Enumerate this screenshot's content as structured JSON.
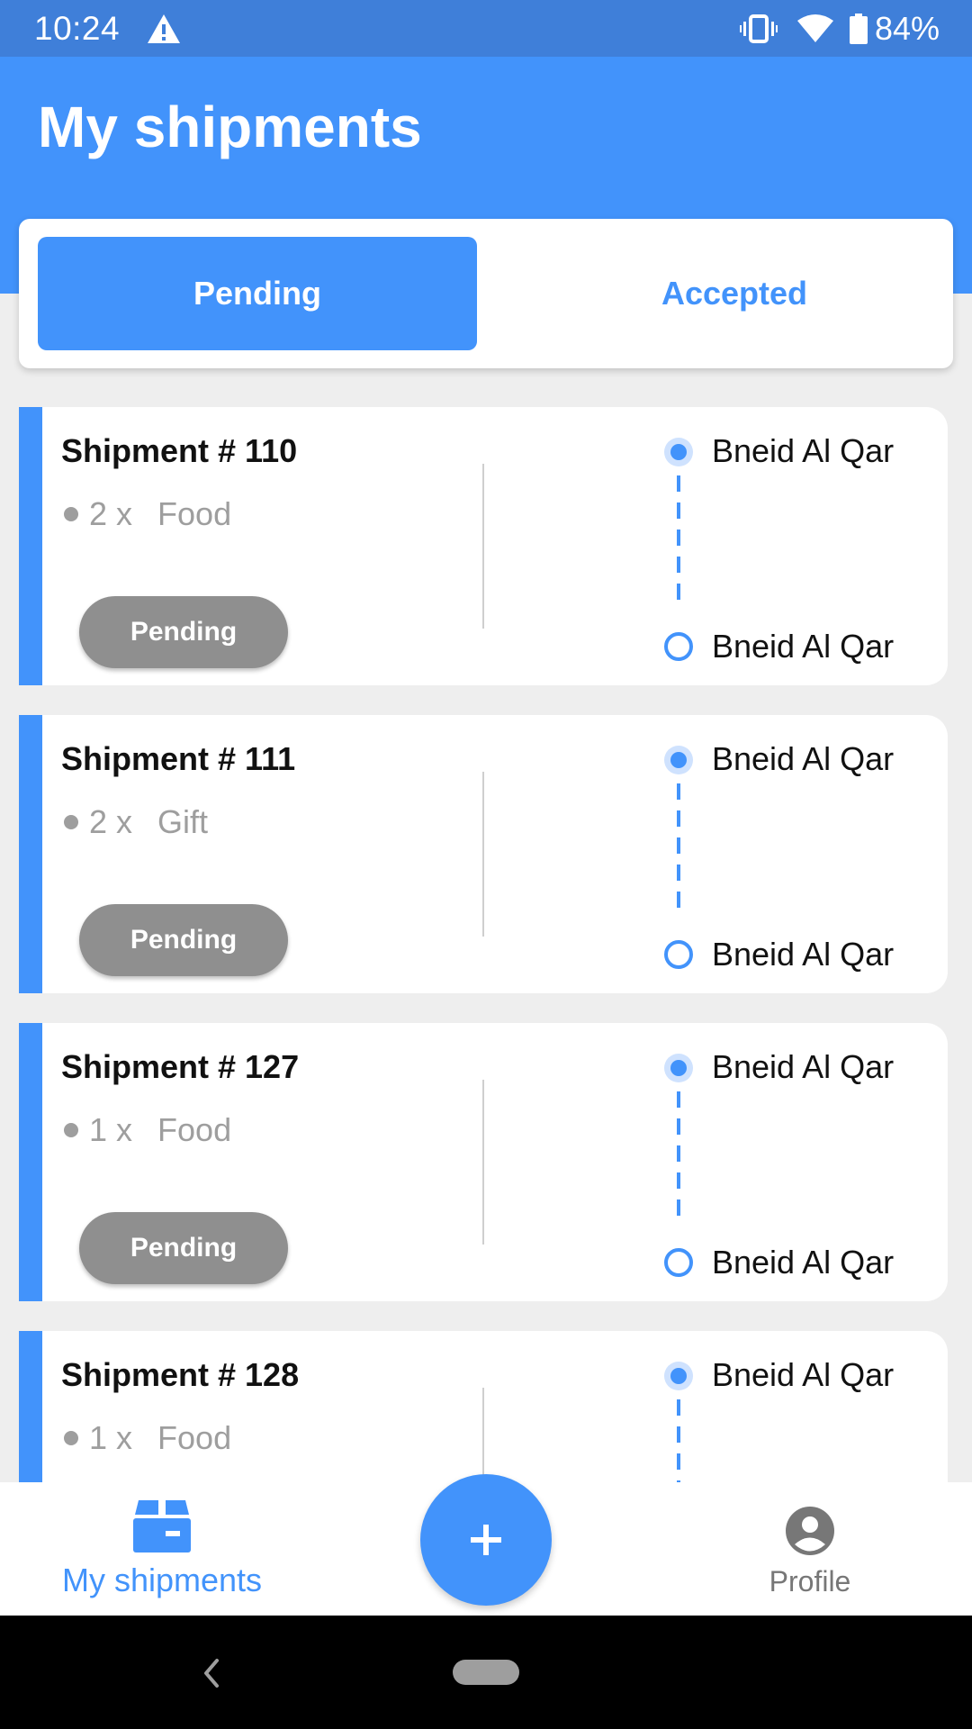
{
  "status_bar": {
    "time": "10:24",
    "battery": "84%",
    "icons": [
      "warning-icon",
      "vibrate-icon",
      "wifi-icon",
      "battery-icon"
    ]
  },
  "header": {
    "title": "My shipments"
  },
  "tabs": [
    {
      "label": "Pending",
      "selected": true
    },
    {
      "label": "Accepted",
      "selected": false
    }
  ],
  "shipments": [
    {
      "title": "Shipment # 110",
      "quantity": "2 x",
      "item": "Food",
      "status": "Pending",
      "from": "Bneid Al Qar",
      "to": "Bneid Al Qar"
    },
    {
      "title": "Shipment # 111",
      "quantity": "2 x",
      "item": "Gift",
      "status": "Pending",
      "from": "Bneid Al Qar",
      "to": "Bneid Al Qar"
    },
    {
      "title": "Shipment # 127",
      "quantity": "1 x",
      "item": "Food",
      "status": "Pending",
      "from": "Bneid Al Qar",
      "to": "Bneid Al Qar"
    },
    {
      "title": "Shipment # 128",
      "quantity": "1 x",
      "item": "Food",
      "from": "Bneid Al Qar"
    }
  ],
  "bottom_nav": {
    "shipments_label": "My shipments",
    "profile_label": "Profile",
    "fab_icon": "plus-icon"
  },
  "colors": {
    "primary": "#4293FB",
    "status_bar": "#3F7FD9",
    "pill_gray": "#8F8F8F",
    "background": "#EEEEEE"
  }
}
